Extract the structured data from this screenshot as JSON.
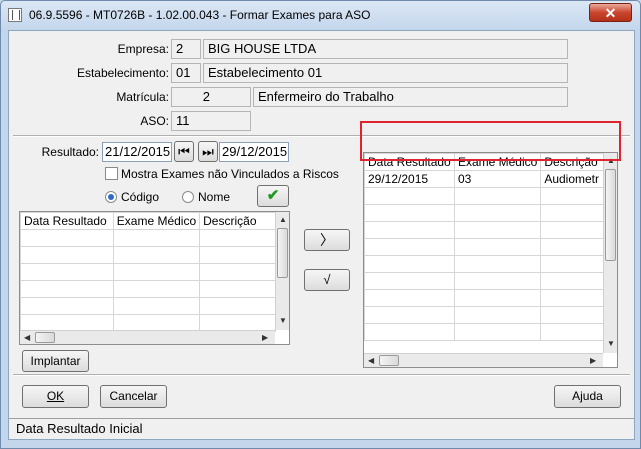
{
  "window": {
    "title": "06.9.5596 - MT0726B - 1.02.00.043 - Formar Exames para ASO",
    "close_glyph": "✕"
  },
  "header": {
    "empresa_label": "Empresa:",
    "empresa_code": "2",
    "empresa_name": "BIG HOUSE LTDA",
    "estab_label": "Estabelecimento:",
    "estab_code": "01",
    "estab_name": "Estabelecimento 01",
    "matricula_label": "Matrícula:",
    "matricula_code": "2",
    "matricula_name": "Enfermeiro do Trabalho",
    "aso_label": "ASO:",
    "aso_code": "11"
  },
  "filter": {
    "resultado_label": "Resultado:",
    "date_from": "21/12/2015",
    "date_to": "29/12/2015",
    "checkbox_label": "Mostra Exames não Vinculados a Riscos",
    "radio_codigo": "Código",
    "radio_nome": "Nome",
    "ok_icon": "✔"
  },
  "left_grid": {
    "columns": [
      "Data Resultado",
      "Exame Médico",
      "Descrição"
    ],
    "rows": []
  },
  "right_grid": {
    "columns": [
      "Data Resultado",
      "Exame Médico",
      "Descrição"
    ],
    "rows": [
      [
        "29/12/2015",
        "03",
        "Audiometr"
      ]
    ]
  },
  "move_buttons": {
    "add": "〉",
    "remove": "√"
  },
  "buttons": {
    "implantar": "Implantar",
    "ok": "OK",
    "cancelar": "Cancelar",
    "ajuda": "Ajuda"
  },
  "statusbar": {
    "text": "Data Resultado Inicial"
  }
}
